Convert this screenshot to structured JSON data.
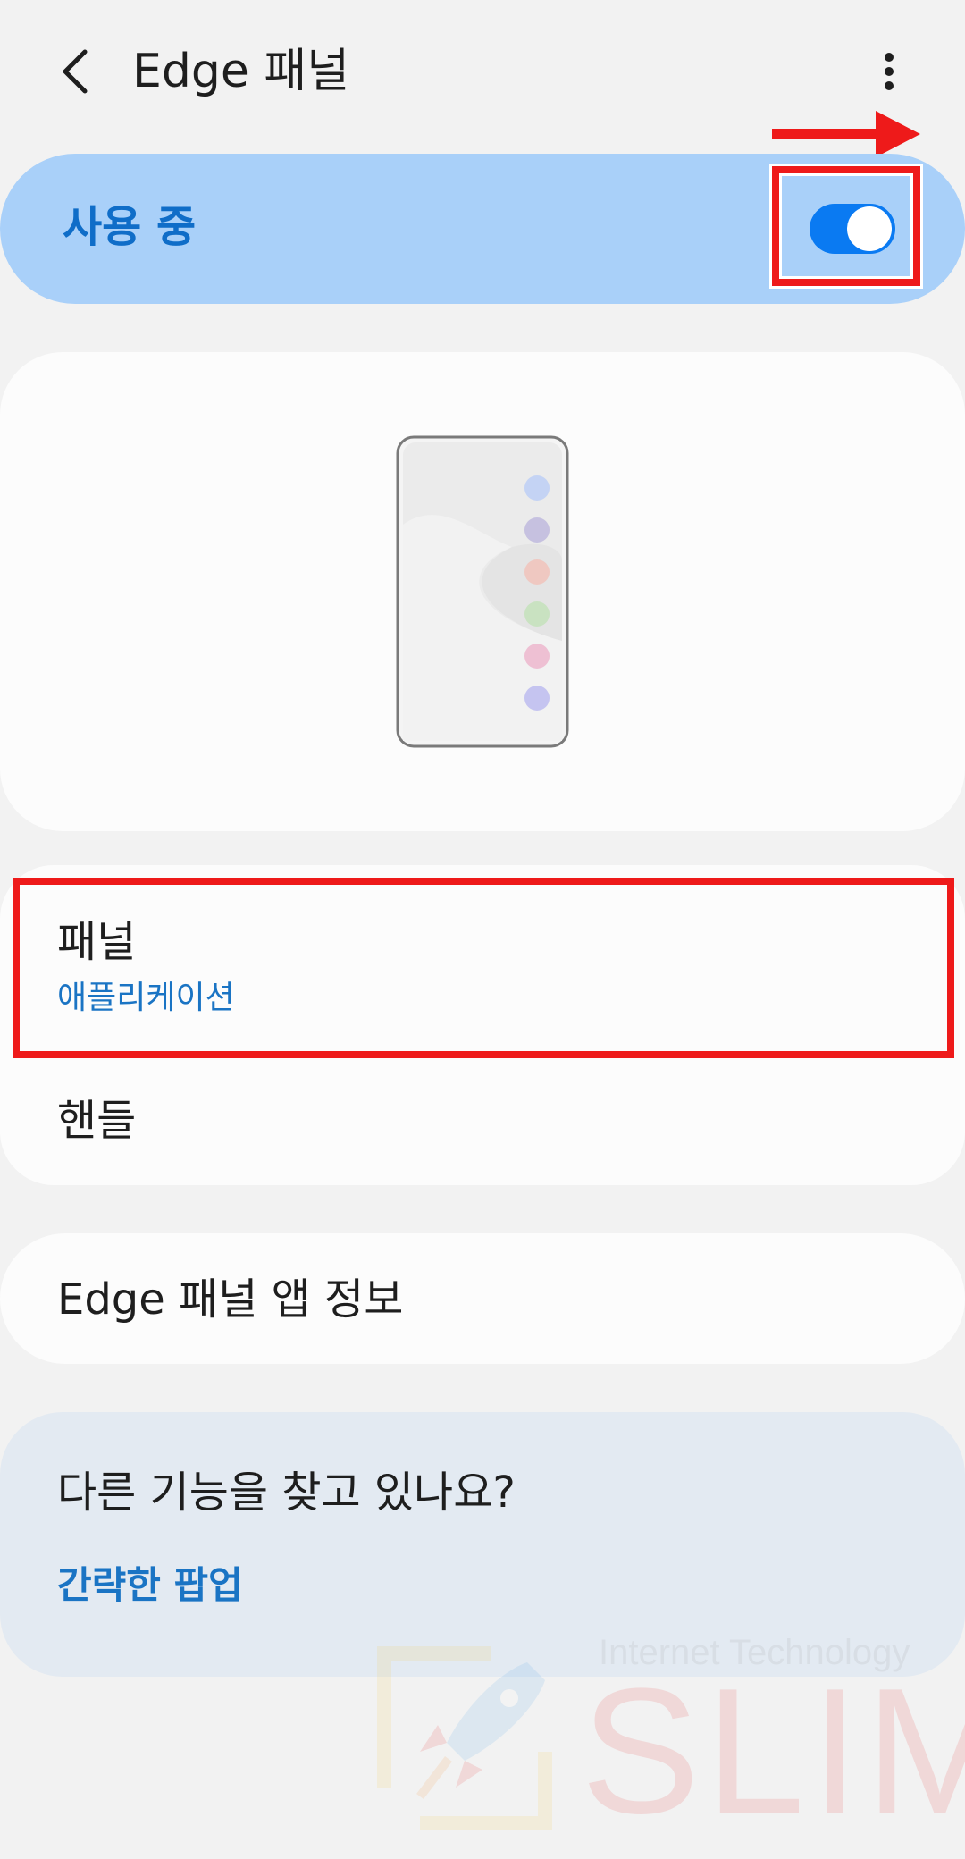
{
  "header": {
    "title": "Edge 패널",
    "back_icon": "chevron-left-icon",
    "more_icon": "more-vertical-icon"
  },
  "master_switch": {
    "label": "사용 중",
    "state": "on",
    "accent_color": "#0a7af2"
  },
  "preview": {
    "dot_colors": [
      "#c4d3f4",
      "#c6c1e0",
      "#efc8c1",
      "#c9e2c1",
      "#eec0d3",
      "#c5c4f0"
    ]
  },
  "list": {
    "panel": {
      "title": "패널",
      "subtitle": "애플리케이션"
    },
    "handle": {
      "title": "핸들"
    }
  },
  "app_info": {
    "label": "Edge 패널 앱 정보"
  },
  "suggestion": {
    "title": "다른 기능을 찾고 있나요?",
    "link": "간략한 팝업"
  },
  "watermark": {
    "tagline": "Internet Technology",
    "brand": "SLIM"
  },
  "colors": {
    "background": "#f2f2f2",
    "card": "#fcfcfc",
    "switch_bar": "#a9d0f9",
    "link": "#1a74c4",
    "annotation": "#ee1a1a"
  }
}
